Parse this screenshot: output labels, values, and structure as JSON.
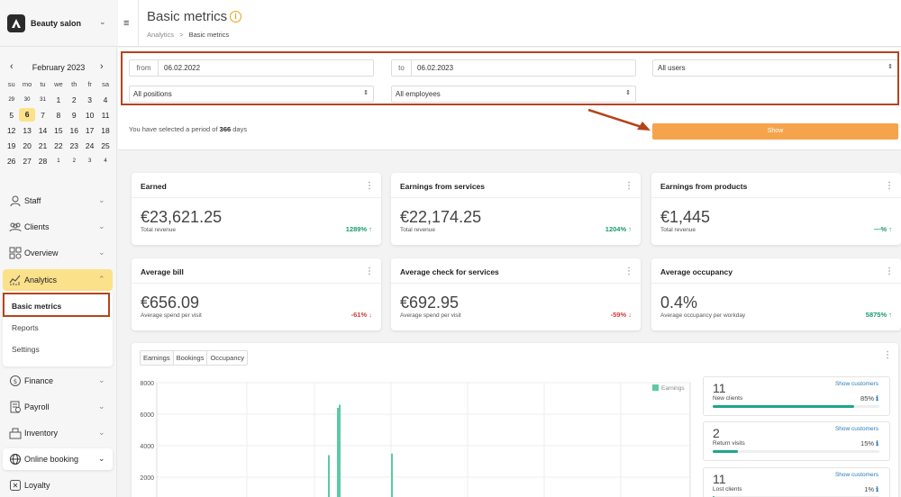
{
  "brand": {
    "name": "Beauty salon"
  },
  "calendar": {
    "month": "February 2023",
    "dows": [
      "su",
      "mo",
      "tu",
      "we",
      "th",
      "fr",
      "sa"
    ],
    "weeks": [
      [
        "29",
        "30",
        "31",
        "1",
        "2",
        "3",
        "4"
      ],
      [
        "5",
        "6",
        "7",
        "8",
        "9",
        "10",
        "11"
      ],
      [
        "12",
        "13",
        "14",
        "15",
        "16",
        "17",
        "18"
      ],
      [
        "19",
        "20",
        "21",
        "22",
        "23",
        "24",
        "25"
      ],
      [
        "26",
        "27",
        "28",
        "1",
        "2",
        "3",
        "4"
      ]
    ],
    "selected": "6"
  },
  "nav": {
    "staff": "Staff",
    "clients": "Clients",
    "overview": "Overview",
    "analytics": "Analytics",
    "basic_metrics": "Basic metrics",
    "reports": "Reports",
    "settings": "Settings",
    "finance": "Finance",
    "payroll": "Payroll",
    "inventory": "Inventory",
    "online_booking": "Online booking",
    "loyalty": "Loyalty"
  },
  "header": {
    "title": "Basic metrics",
    "crumb_root": "Analytics",
    "crumb_sep": ">",
    "crumb_current": "Basic metrics"
  },
  "filters": {
    "from_label": "from",
    "from_value": "06.02.2022",
    "to_label": "to",
    "to_value": "06.02.2023",
    "users": "All users",
    "positions": "All positions",
    "employees": "All employees",
    "period_prefix": "You have selected a period of",
    "period_days": "366",
    "period_suffix": "days",
    "show": "Show"
  },
  "cards": [
    {
      "title": "Earned",
      "value": "€23,621.25",
      "sub": "Total revenue",
      "pct": "1289%",
      "dir": "up"
    },
    {
      "title": "Earnings from services",
      "value": "€22,174.25",
      "sub": "Total revenue",
      "pct": "1204%",
      "dir": "up"
    },
    {
      "title": "Earnings from products",
      "value": "€1,445",
      "sub": "Total revenue",
      "pct": "—%",
      "dir": "up"
    },
    {
      "title": "Average bill",
      "value": "€656.09",
      "sub": "Average spend per visit",
      "pct": "-61%",
      "dir": "down"
    },
    {
      "title": "Average check for services",
      "value": "€692.95",
      "sub": "Average spend per visit",
      "pct": "-59%",
      "dir": "down"
    },
    {
      "title": "Average occupancy",
      "value": "0.4%",
      "sub": "Average occupancy per workday",
      "pct": "5875%",
      "dir": "up"
    }
  ],
  "chart_tabs": [
    "Earnings",
    "Bookings",
    "Occupancy"
  ],
  "chart_data": {
    "type": "bar",
    "series": [
      {
        "name": "Earnings",
        "values": [
          3400,
          6400,
          6600,
          3500
        ]
      }
    ],
    "yticks": [
      "8000",
      "6000",
      "4000",
      "2000"
    ],
    "ylim": [
      0,
      8000
    ],
    "color": "#5cc9a7"
  },
  "stats": [
    {
      "number": "11",
      "label": "New clients",
      "link": "Show customers",
      "pct": "85%",
      "fill": 0.85
    },
    {
      "number": "2",
      "label": "Return visits",
      "link": "Show customers",
      "pct": "15%",
      "fill": 0.15
    },
    {
      "number": "11",
      "label": "Lost clients",
      "link": "Show customers",
      "pct": "1%",
      "fill": 0.01
    }
  ],
  "colors": {
    "accent": "#fbe18a",
    "highlight": "#b5441a",
    "button": "#f6a44c",
    "positive": "#1a9b6b",
    "negative": "#d23c3c"
  }
}
